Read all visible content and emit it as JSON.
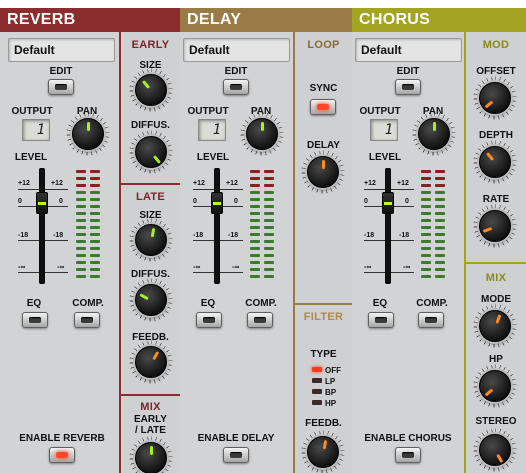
{
  "colors": {
    "reverb": "#8b2c2e",
    "delay": "#9a7b45",
    "chorus": "#a3a422",
    "knob_indicator_green": "#a8f020",
    "knob_indicator_orange": "#ff8a20",
    "led_red": "#ff3a1a",
    "meter_red": "#8a2020",
    "meter_green": "#3c7a2c"
  },
  "reverb": {
    "title": "REVERB",
    "preset": "Default",
    "edit_label": "EDIT",
    "output_label": "OUTPUT",
    "output_value": "1",
    "pan_label": "PAN",
    "level_label": "LEVEL",
    "scale": {
      "plus12": "+12",
      "zero": "0",
      "minus18": "-18",
      "minf": "-∞"
    },
    "eq_label": "EQ",
    "comp_label": "COMP.",
    "enable_label": "ENABLE REVERB",
    "early": {
      "title": "EARLY",
      "size_label": "SIZE",
      "diffus_label": "DIFFUS."
    },
    "late": {
      "title": "LATE",
      "size_label": "SIZE",
      "diffus_label": "DIFFUS.",
      "feedb_label": "FEEDB."
    },
    "mix": {
      "title": "MIX",
      "early_late_label_1": "EARLY",
      "early_late_label_2": "/ LATE"
    }
  },
  "delay": {
    "title": "DELAY",
    "preset": "Default",
    "edit_label": "EDIT",
    "output_label": "OUTPUT",
    "output_value": "1",
    "pan_label": "PAN",
    "level_label": "LEVEL",
    "scale": {
      "plus12": "+12",
      "zero": "0",
      "minus18": "-18",
      "minf": "-∞"
    },
    "eq_label": "EQ",
    "comp_label": "COMP.",
    "enable_label": "ENABLE DELAY",
    "loop": {
      "title": "LOOP",
      "sync_label": "SYNC",
      "delay_label": "DELAY"
    },
    "filter": {
      "title": "FILTER",
      "type_label": "TYPE",
      "options": [
        "OFF",
        "LP",
        "BP",
        "HP"
      ],
      "selected": "OFF",
      "feedb_label": "FEEDB."
    }
  },
  "chorus": {
    "title": "CHORUS",
    "preset": "Default",
    "edit_label": "EDIT",
    "output_label": "OUTPUT",
    "output_value": "1",
    "pan_label": "PAN",
    "level_label": "LEVEL",
    "scale": {
      "plus12": "+12",
      "zero": "0",
      "minus18": "-18",
      "minf": "-∞"
    },
    "eq_label": "EQ",
    "comp_label": "COMP.",
    "enable_label": "ENABLE CHORUS",
    "mod": {
      "title": "MOD",
      "offset_label": "OFFSET",
      "depth_label": "DEPTH",
      "rate_label": "RATE"
    },
    "mix": {
      "title": "MIX",
      "mode_label": "MODE",
      "hp_label": "HP",
      "stereo_label": "STEREO"
    }
  }
}
